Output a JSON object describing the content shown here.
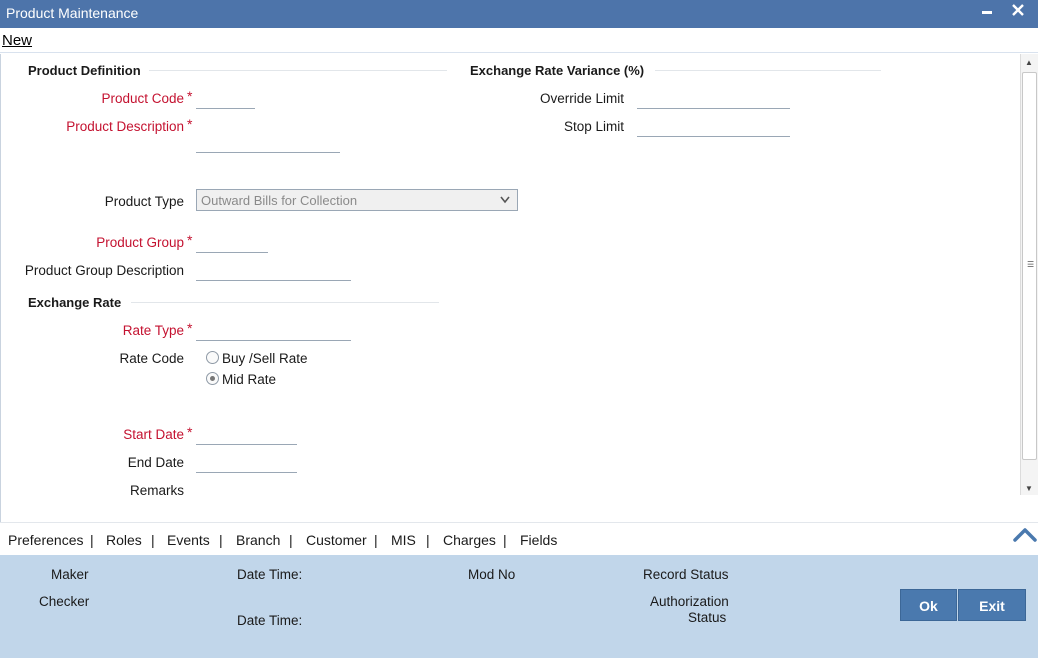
{
  "window": {
    "title": "Product Maintenance",
    "minimize_glyph": "▬",
    "close_glyph": "✕"
  },
  "menu": {
    "new_label": "New"
  },
  "product_definition": {
    "section_title": "Product Definition",
    "product_code_label": "Product Code",
    "product_code_value": "",
    "product_description_label": "Product Description",
    "product_description_value": "",
    "product_type_label": "Product Type",
    "product_type_value": "Outward Bills for Collection",
    "product_group_label": "Product Group",
    "product_group_value": "",
    "product_group_description_label": "Product Group Description",
    "product_group_description_value": ""
  },
  "exchange_rate_variance": {
    "section_title": "Exchange Rate Variance (%)",
    "override_limit_label": "Override Limit",
    "override_limit_value": "",
    "stop_limit_label": "Stop Limit",
    "stop_limit_value": ""
  },
  "exchange_rate": {
    "section_title": "Exchange Rate",
    "rate_type_label": "Rate Type",
    "rate_type_value": "",
    "rate_code_label": "Rate Code",
    "rate_code_options": [
      "Buy /Sell Rate",
      "Mid Rate"
    ],
    "rate_code_selected": "Mid Rate"
  },
  "dates": {
    "start_date_label": "Start Date",
    "start_date_value": "",
    "end_date_label": "End Date",
    "end_date_value": "",
    "remarks_label": "Remarks"
  },
  "required_marker": "*",
  "tabs": [
    "Preferences",
    "Roles",
    "Events",
    "Branch",
    "Customer",
    "MIS",
    "Charges",
    "Fields"
  ],
  "tab_separator": "|",
  "footer": {
    "maker_label": "Maker",
    "checker_label": "Checker",
    "date_time_label": "Date Time:",
    "mod_no_label": "Mod No",
    "record_status_label": "Record Status",
    "authorization_label": "Authorization",
    "status_label": "Status",
    "ok_label": "Ok",
    "exit_label": "Exit"
  },
  "colors": {
    "titlebar": "#4d74aa",
    "required_label": "#c41230",
    "footer_bg": "#c1d6ea",
    "button_bg": "#4a79ae"
  }
}
